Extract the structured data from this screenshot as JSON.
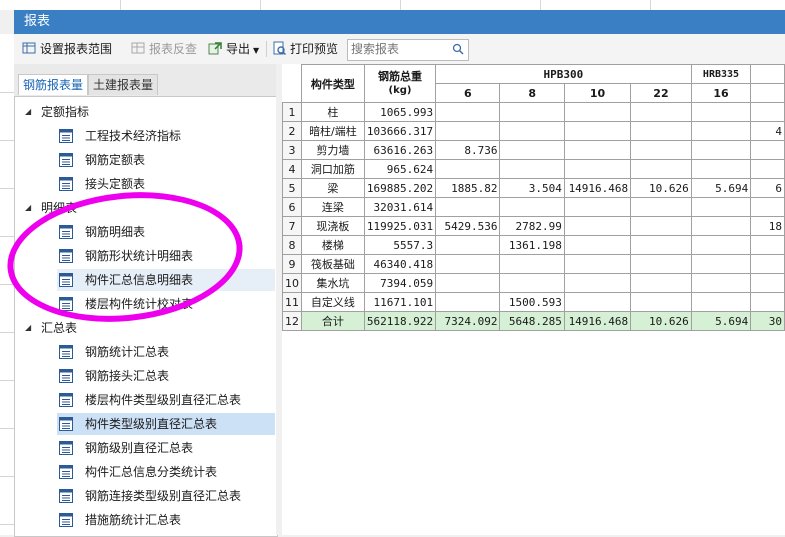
{
  "window": {
    "title": "报表"
  },
  "toolbar": {
    "set_range": "设置报表范围",
    "reverse": "报表反查",
    "export": "导出",
    "print_preview": "打印预览",
    "search_placeholder": "搜索报表"
  },
  "tabs": {
    "rebar": "钢筋报表量",
    "civil": "土建报表量"
  },
  "tree": {
    "groups": [
      {
        "label": "定额指标",
        "items": [
          "工程技术经济指标",
          "钢筋定额表",
          "接头定额表"
        ]
      },
      {
        "label": "明细表",
        "items": [
          "钢筋明细表",
          "钢筋形状统计明细表",
          "构件汇总信息明细表",
          "楼层构件统计校对表"
        ]
      },
      {
        "label": "汇总表",
        "items": [
          "钢筋统计汇总表",
          "钢筋接头汇总表",
          "楼层构件类型级别直径汇总表",
          "构件类型级别直径汇总表",
          "钢筋级别直径汇总表",
          "构件汇总信息分类统计表",
          "钢筋连接类型级别直径汇总表",
          "措施筋统计汇总表"
        ]
      }
    ],
    "selected": "构件类型级别直径汇总表",
    "hovered": "构件汇总信息明细表"
  },
  "annotation": {
    "color": "#ee00ee"
  },
  "table": {
    "header": {
      "type": "构件类型",
      "total_weight": "钢筋总重",
      "unit": "(kg)",
      "grade1": "HPB300",
      "grade2": "HRB335",
      "diameters": [
        "6",
        "8",
        "10",
        "22",
        "16"
      ]
    },
    "rows": [
      {
        "n": "1",
        "name": "柱",
        "total": "1065.993",
        "c": [
          "",
          "",
          "",
          "",
          "",
          ""
        ]
      },
      {
        "n": "2",
        "name": "暗柱/端柱",
        "total": "103666.317",
        "c": [
          "",
          "",
          "",
          "",
          "",
          "4"
        ]
      },
      {
        "n": "3",
        "name": "剪力墙",
        "total": "63616.263",
        "c": [
          "8.736",
          "",
          "",
          "",
          "",
          ""
        ]
      },
      {
        "n": "4",
        "name": "洞口加筋",
        "total": "965.624",
        "c": [
          "",
          "",
          "",
          "",
          "",
          ""
        ]
      },
      {
        "n": "5",
        "name": "梁",
        "total": "169885.202",
        "c": [
          "1885.82",
          "3.504",
          "14916.468",
          "10.626",
          "5.694",
          "6"
        ]
      },
      {
        "n": "6",
        "name": "连梁",
        "total": "32031.614",
        "c": [
          "",
          "",
          "",
          "",
          "",
          ""
        ]
      },
      {
        "n": "7",
        "name": "现浇板",
        "total": "119925.031",
        "c": [
          "5429.536",
          "2782.99",
          "",
          "",
          "",
          "18"
        ]
      },
      {
        "n": "8",
        "name": "楼梯",
        "total": "5557.3",
        "c": [
          "",
          "1361.198",
          "",
          "",
          "",
          ""
        ]
      },
      {
        "n": "9",
        "name": "筏板基础",
        "total": "46340.418",
        "c": [
          "",
          "",
          "",
          "",
          "",
          ""
        ]
      },
      {
        "n": "10",
        "name": "集水坑",
        "total": "7394.059",
        "c": [
          "",
          "",
          "",
          "",
          "",
          ""
        ]
      },
      {
        "n": "11",
        "name": "自定义线",
        "total": "11671.101",
        "c": [
          "",
          "1500.593",
          "",
          "",
          "",
          ""
        ]
      },
      {
        "n": "12",
        "name": "合计",
        "total": "562118.922",
        "c": [
          "7324.092",
          "5648.285",
          "14916.468",
          "10.626",
          "5.694",
          "30"
        ]
      }
    ]
  }
}
